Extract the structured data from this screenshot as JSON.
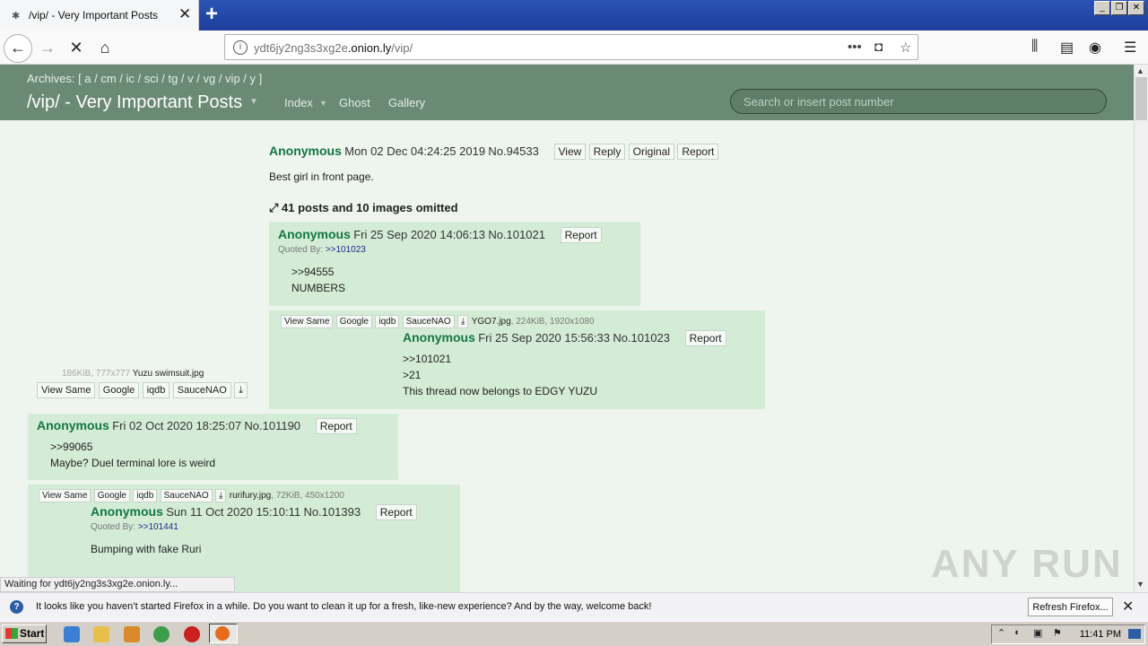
{
  "browser": {
    "tab_title": "/vip/ - Very Important Posts",
    "url_host": "ydt6jy2ng3s3xg2e",
    "url_domain": ".onion.ly",
    "url_path": "/vip/",
    "status_text": "Waiting for ydt6jy2ng3s3xg2e.onion.ly...",
    "notification_text": "It looks like you haven’t started Firefox in a while. Do you want to clean it up for a fresh, like-new experience? And by the way, welcome back!",
    "refresh_label": "Refresh Firefox...",
    "watermark": "ANY RUN"
  },
  "site": {
    "archives": "Archives: [ a / cm / ic / sci / tg / v / vg / vip / y ]",
    "board_title": "/vip/ - Very Important Posts",
    "nav": [
      "Index",
      "Ghost",
      "Gallery"
    ],
    "search_placeholder": "Search or insert post number"
  },
  "thread": {
    "op": {
      "name": "Anonymous",
      "date": "Mon 02 Dec 04:24:25 2019",
      "number": "No.94533",
      "buttons": [
        "View",
        "Reply",
        "Original",
        "Report"
      ],
      "message": "Best girl in front page.",
      "omitted": "41 posts and 10 images omitted",
      "file_info": "186KiB, 777x777",
      "file_name": "Yuzu swimsuit.jpg",
      "search_buttons": [
        "View Same",
        "Google",
        "iqdb",
        "SauceNAO"
      ]
    },
    "replies": [
      {
        "name": "Anonymous",
        "date": "Fri 25 Sep 2020 14:06:13",
        "number": "No.101021",
        "report": "Report",
        "quoted_by_label": "Quoted By:",
        "quoted_by": ">>101023",
        "lines": [
          ">>94555",
          "NUMBERS"
        ]
      },
      {
        "name": "Anonymous",
        "date": "Fri 25 Sep 2020 15:56:33",
        "number": "No.101023",
        "report": "Report",
        "search_buttons": [
          "View Same",
          "Google",
          "iqdb",
          "SauceNAO"
        ],
        "file_name": "YGO7.jpg",
        "file_info": ", 224KiB, 1920x1080",
        "line1": ">>101021",
        "line2": ">21",
        "line3": "This thread now belongs to EDGY YUZU"
      },
      {
        "name": "Anonymous",
        "date": "Fri 02 Oct 2020 18:25:07",
        "number": "No.101190",
        "report": "Report",
        "lines": [
          ">>99065",
          "Maybe? Duel terminal lore is weird"
        ]
      },
      {
        "name": "Anonymous",
        "date": "Sun 11 Oct 2020 15:10:11",
        "number": "No.101393",
        "report": "Report",
        "search_buttons": [
          "View Same",
          "Google",
          "iqdb",
          "SauceNAO"
        ],
        "file_name": "rurifury.jpg",
        "file_info": ", 72KiB, 450x1200",
        "quoted_by_label": "Quoted By:",
        "quoted_by": ">>101441",
        "message": "Bumping with fake Ruri"
      }
    ]
  },
  "taskbar": {
    "start_label": "Start",
    "clock": "11:41 PM"
  }
}
